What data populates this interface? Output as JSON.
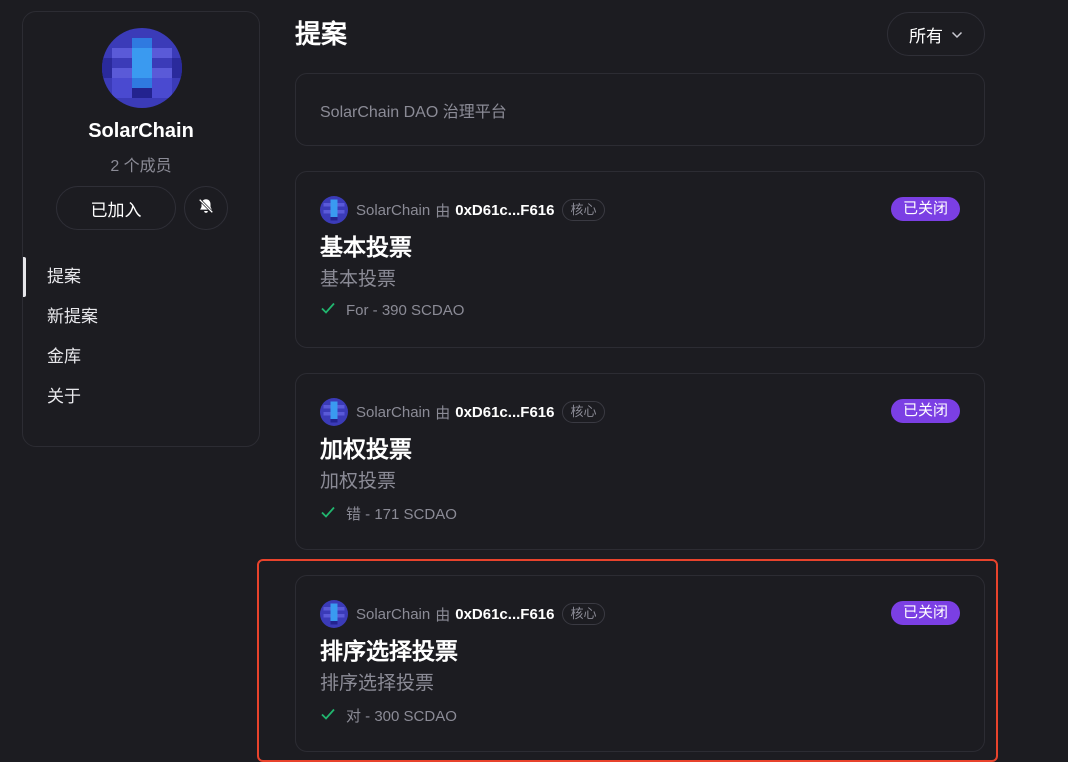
{
  "sidebar": {
    "space_name": "SolarChain",
    "member_count": "2 个成员",
    "join_label": "已加入",
    "nav": [
      {
        "label": "提案"
      },
      {
        "label": "新提案"
      },
      {
        "label": "金库"
      },
      {
        "label": "关于"
      }
    ]
  },
  "main": {
    "title": "提案",
    "filter_label": "所有",
    "about_text": "SolarChain DAO 治理平台"
  },
  "proposals": [
    {
      "space": "SolarChain",
      "by": "由",
      "author": "0xD61c...F616",
      "badge": "核心",
      "status": "已关闭",
      "title": "基本投票",
      "description": "基本投票",
      "result": "For - 390 SCDAO"
    },
    {
      "space": "SolarChain",
      "by": "由",
      "author": "0xD61c...F616",
      "badge": "核心",
      "status": "已关闭",
      "title": "加权投票",
      "description": "加权投票",
      "result": "错 - 171 SCDAO"
    },
    {
      "space": "SolarChain",
      "by": "由",
      "author": "0xD61c...F616",
      "badge": "核心",
      "status": "已关闭",
      "title": "排序选择投票",
      "description": "排序选择投票",
      "result": "对 - 300 SCDAO"
    }
  ],
  "colors": {
    "background": "#1c1c21",
    "border": "#2c2c33",
    "muted_text": "#8b8b96",
    "status_closed": "#7b3fe4",
    "check": "#21b66f",
    "highlight": "#e8432c"
  },
  "icons": {
    "bell": "bell-off-icon",
    "chevron": "chevron-down-icon",
    "check": "check-icon"
  }
}
